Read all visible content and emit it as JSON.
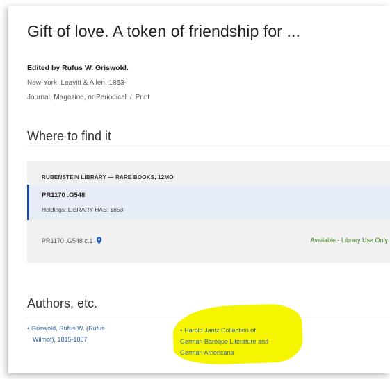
{
  "record": {
    "title": "Gift of love. A token of friendship for ...",
    "editor": "Edited by Rufus W. Griswold.",
    "publication": "New-York, Leavitt & Allen, 1853-",
    "format": "Journal, Magazine, or Periodical",
    "format_separator": "/",
    "medium": "Print"
  },
  "where_to_find": {
    "heading": "Where to find it",
    "library": "RUBENSTEIN LIBRARY — RARE BOOKS, 12MO",
    "call_number": "PR1170 .G548",
    "holdings": "Holdings: LIBRARY HAS: 1853",
    "item_call_number": "PR1170 .G548 c.1",
    "availability": "Available - Library Use Only",
    "location_icon": "map-pin-icon",
    "availability_color": "#3a7d1e",
    "selected_row_color": "#e7edf7",
    "selected_row_accent": "#1f4d9c"
  },
  "authors": {
    "heading": "Authors, etc.",
    "bullet": "•",
    "items": [
      {
        "lines": [
          "Griswold, Rufus W. (Rufus",
          "Wilmot), 1815-1857"
        ]
      },
      {
        "lines": [
          "Harold Jantz Collection of",
          "German Baroque Literature and",
          "German Americana"
        ],
        "highlighted": true
      }
    ],
    "link_color": "#3360a8",
    "highlight_color": "#f5f500"
  }
}
